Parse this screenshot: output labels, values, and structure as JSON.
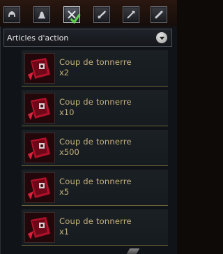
{
  "tabs": [
    {
      "icon": "helmet-icon"
    },
    {
      "icon": "bell-icon"
    },
    {
      "icon": "crossed-tools-icon",
      "active": true
    },
    {
      "icon": "sword-icon"
    },
    {
      "icon": "staff-icon"
    },
    {
      "icon": "scroll-icon"
    }
  ],
  "dropdown": {
    "selected": "Articles d'action"
  },
  "items": [
    {
      "name": "Coup de tonnerre",
      "qty": "x2"
    },
    {
      "name": "Coup de tonnerre",
      "qty": "x10"
    },
    {
      "name": "Coup de tonnerre",
      "qty": "x500"
    },
    {
      "name": "Coup de tonnerre",
      "qty": "x5"
    },
    {
      "name": "Coup de tonnerre",
      "qty": "x1"
    }
  ],
  "colors": {
    "item_text": "#c6b27a",
    "divider": "#6a6239",
    "panel_bg": "#101317"
  }
}
